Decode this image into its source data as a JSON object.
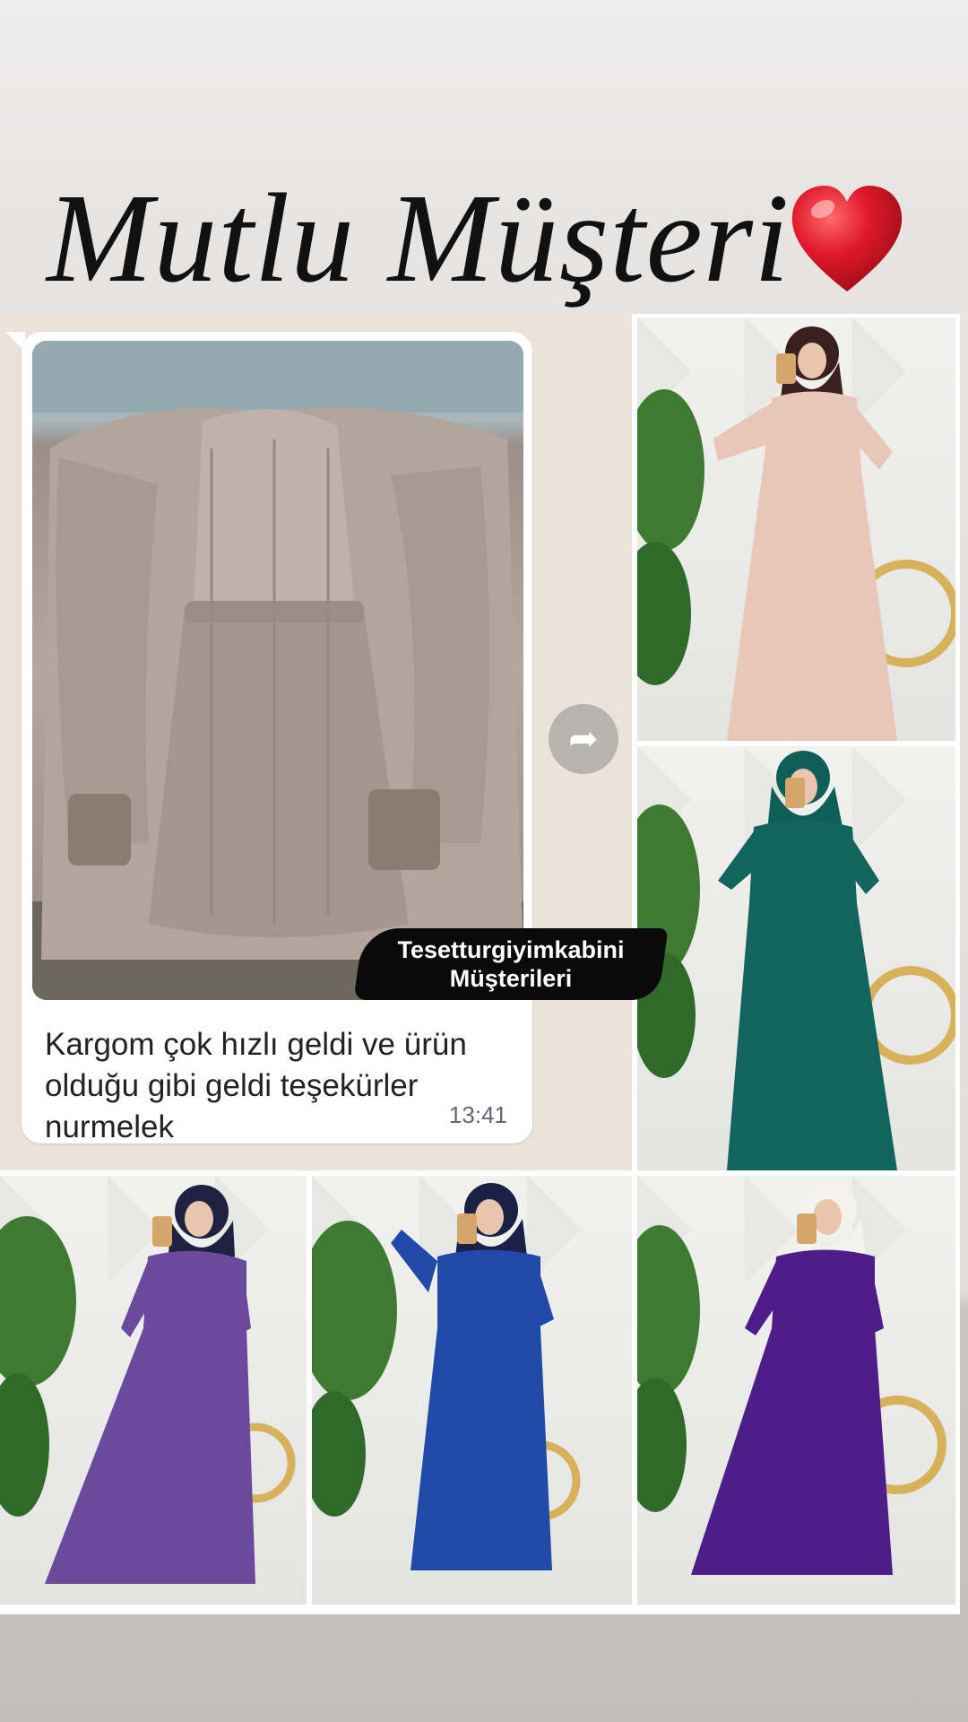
{
  "title": "Mutlu Müşteri",
  "icons": {
    "heart": "heart-emoji-icon",
    "forward": "forward-arrow-icon"
  },
  "chat": {
    "message": "Kargom çok hızlı geldi ve ürün olduğu gibi geldi teşekürler nurmelek",
    "time": "13:41"
  },
  "watermark": {
    "line1": "Tesetturgiyimkabini",
    "line2": "Müşterileri"
  },
  "products": [
    {
      "dress_color": "#e8c7b8",
      "hijab_color": "#3b2020"
    },
    {
      "dress_color": "#11655c",
      "hijab_color": "#0f5f58"
    },
    {
      "dress_color": "#6b4a9e",
      "hijab_color": "#1e2240"
    },
    {
      "dress_color": "#2149a8",
      "hijab_color": "#1b2146"
    },
    {
      "dress_color": "#4e1d87",
      "hijab_color": "#f4f2ee"
    }
  ],
  "colors": {
    "heart": "#e0192b",
    "chat_bg": "#ebe3da",
    "bubble": "#ffffff"
  }
}
